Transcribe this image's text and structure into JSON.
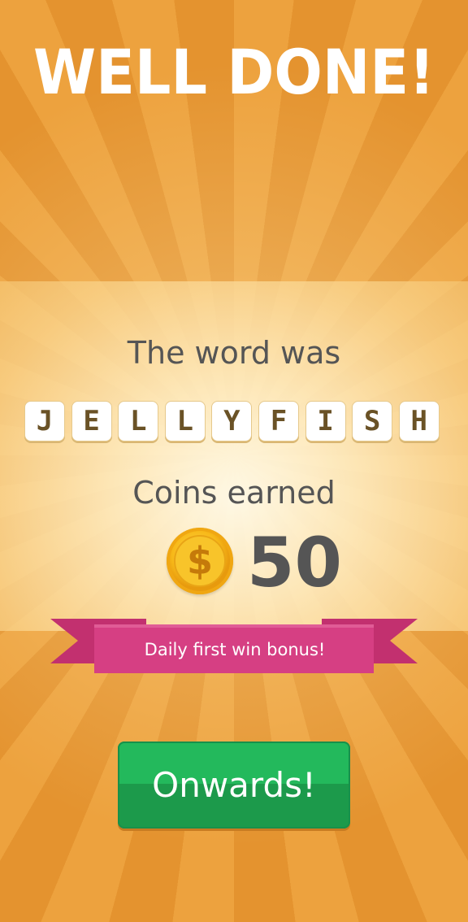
{
  "header": {
    "title": "WELL DONE!"
  },
  "result": {
    "word_label": "The word was",
    "word_letters": [
      "J",
      "E",
      "L",
      "L",
      "Y",
      "F",
      "I",
      "S",
      "H"
    ],
    "coins_label": "Coins earned",
    "coin_icon": "dollar-coin-icon",
    "coin_symbol": "$",
    "coins_value": "50"
  },
  "banner": {
    "label": "Daily first win bonus!"
  },
  "actions": {
    "onwards_label": "Onwards!"
  },
  "colors": {
    "background": "#e89a38",
    "ribbon": "#d63f83",
    "button": "#23b95c",
    "text_dark": "#555555"
  }
}
